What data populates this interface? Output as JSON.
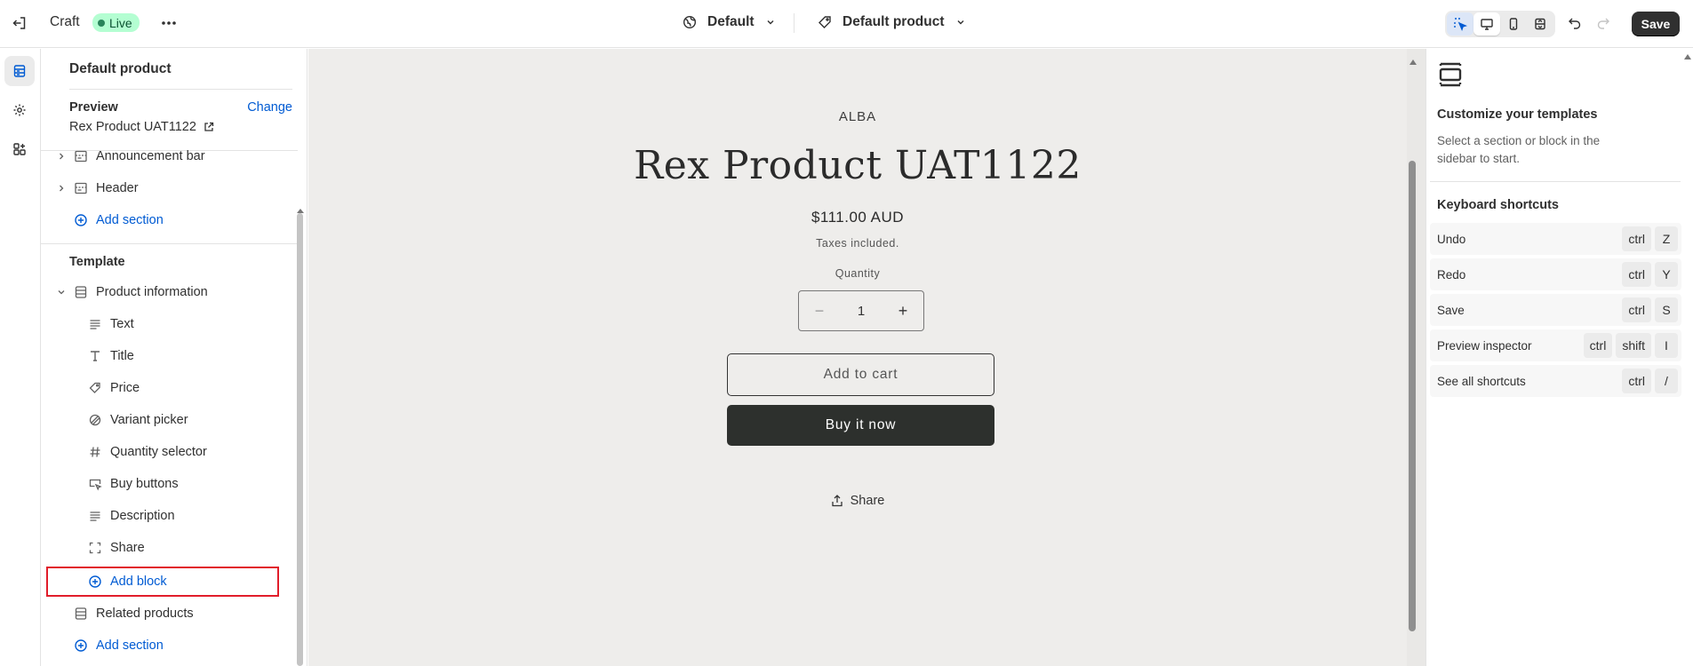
{
  "topbar": {
    "theme_name": "Craft",
    "status_badge": "Live",
    "market": "Default",
    "template": "Default product",
    "save_label": "Save"
  },
  "sidebar": {
    "title": "Default product",
    "preview_label": "Preview",
    "change_label": "Change",
    "preview_value": "Rex Product UAT1122",
    "header_items": [
      {
        "label": "Announcement bar"
      },
      {
        "label": "Header"
      },
      {
        "label": "Add section"
      }
    ],
    "template_label": "Template",
    "product_info": "Product information",
    "blocks": [
      {
        "label": "Text"
      },
      {
        "label": "Title"
      },
      {
        "label": "Price"
      },
      {
        "label": "Variant picker"
      },
      {
        "label": "Quantity selector"
      },
      {
        "label": "Buy buttons"
      },
      {
        "label": "Description"
      },
      {
        "label": "Share"
      },
      {
        "label": "Add block"
      }
    ],
    "related_products": "Related products",
    "add_section_2": "Add section"
  },
  "preview": {
    "vendor": "ALBA",
    "title": "Rex Product UAT1122",
    "price": "$111.00 AUD",
    "tax_note": "Taxes included.",
    "quantity_label": "Quantity",
    "quantity_value": "1",
    "add_to_cart": "Add to cart",
    "buy_now": "Buy it now",
    "share": "Share"
  },
  "right_panel": {
    "title": "Customize your templates",
    "description": "Select a section or block in the sidebar to start.",
    "shortcuts_title": "Keyboard shortcuts",
    "shortcuts": [
      {
        "label": "Undo",
        "keys": [
          "ctrl",
          "Z"
        ]
      },
      {
        "label": "Redo",
        "keys": [
          "ctrl",
          "Y"
        ]
      },
      {
        "label": "Save",
        "keys": [
          "ctrl",
          "S"
        ]
      },
      {
        "label": "Preview inspector",
        "keys": [
          "ctrl",
          "shift",
          "I"
        ]
      },
      {
        "label": "See all shortcuts",
        "keys": [
          "ctrl",
          "/"
        ]
      }
    ]
  },
  "colors": {
    "accent_blue": "#005bd3",
    "live_badge_bg": "#b4fed2",
    "highlight_red": "#e11d2a",
    "buy_button_bg": "#2d302d"
  }
}
